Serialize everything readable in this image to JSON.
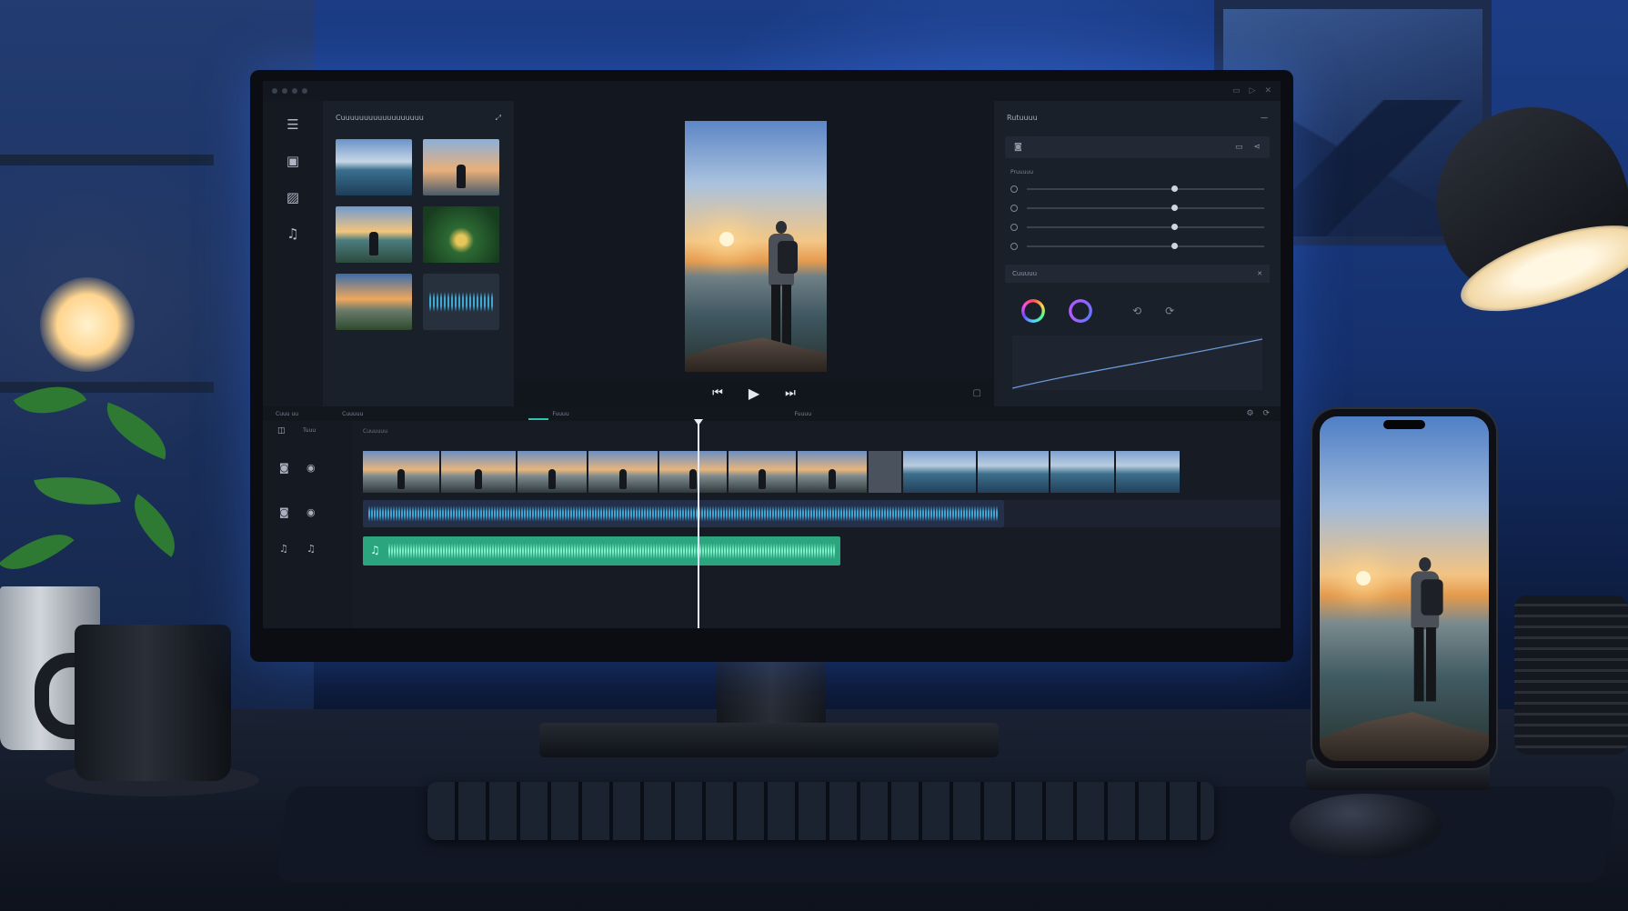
{
  "editor": {
    "media_panel": {
      "title": "Cuuuuuuuuuuuuuuuuuu",
      "thumbnails": [
        {
          "name": "lake-mountains"
        },
        {
          "name": "hiker-sunset"
        },
        {
          "name": "hiker-lake"
        },
        {
          "name": "palm-leaves"
        },
        {
          "name": "mountain-forest"
        },
        {
          "name": "audio-waveform"
        }
      ]
    },
    "right_panel": {
      "title": "Rutuuuu",
      "section_label": "Pruuuuu",
      "sliders": [
        {
          "value": 0.62
        },
        {
          "value": 0.62
        },
        {
          "value": 0.62
        },
        {
          "value": 0.62
        }
      ],
      "color_section": "Cuuuuu"
    },
    "timeline": {
      "tab_left": "Cuuu uu",
      "tab_main": "Cuuuuu",
      "tab_a": "Fuuuu",
      "tab_b": "Fuuuu",
      "track_label": "Tuuu",
      "ruler_label": "Cuuuuuu",
      "footnote": "",
      "playhead_fraction": 0.36
    }
  }
}
